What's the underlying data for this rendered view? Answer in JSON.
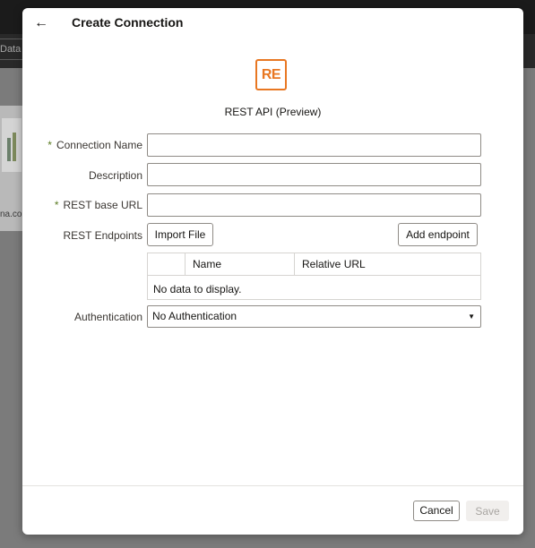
{
  "background": {
    "tab_label": "Data",
    "card_label": "na.co"
  },
  "dialog": {
    "title": "Create Connection",
    "back_icon": "←",
    "connector": {
      "logo_text": "RE",
      "name": "REST API (Preview)",
      "logo_color": "#e87722"
    },
    "fields": {
      "connection_name": {
        "label": "Connection Name",
        "required_mark": "*",
        "value": ""
      },
      "description": {
        "label": "Description",
        "value": ""
      },
      "rest_base_url": {
        "label": "REST base URL",
        "required_mark": "*",
        "value": ""
      }
    },
    "endpoints": {
      "label": "REST Endpoints",
      "import_button": "Import File",
      "add_button": "Add endpoint",
      "columns": [
        "Name",
        "Relative URL"
      ],
      "empty_text": "No data to display."
    },
    "authentication": {
      "label": "Authentication",
      "value": "No Authentication",
      "caret": "▼"
    },
    "footer": {
      "cancel": "Cancel",
      "save": "Save"
    }
  }
}
